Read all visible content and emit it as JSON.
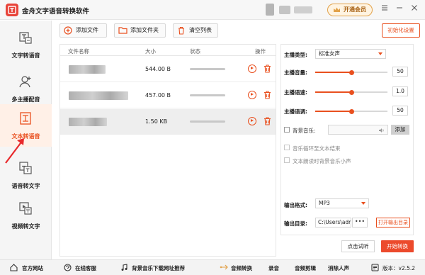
{
  "app": {
    "title": "金舟文字语音转换软件",
    "vip_label": "开通会员",
    "window_controls": [
      "menu-icon",
      "minimize-icon",
      "close-icon"
    ]
  },
  "sidebar": {
    "items": [
      {
        "label": "文字转语音",
        "icon": "text-to-speech-icon",
        "active": false
      },
      {
        "label": "多主播配音",
        "icon": "multi-anchor-icon",
        "active": false
      },
      {
        "label": "文本转语音",
        "icon": "document-to-speech-icon",
        "active": true
      },
      {
        "label": "语音转文字",
        "icon": "speech-to-text-icon",
        "active": false
      },
      {
        "label": "视频转文字",
        "icon": "video-to-text-icon",
        "active": false
      }
    ]
  },
  "toolbar": {
    "add_file": "添加文件",
    "add_folder": "添加文件夹",
    "clear_list": "清空列表",
    "init_settings": "初始化设置"
  },
  "file_table": {
    "columns": [
      "文件名称",
      "大小",
      "状态",
      "操作"
    ],
    "rows": [
      {
        "name_redacted": true,
        "size": "544.00 B",
        "selected": false
      },
      {
        "name_redacted": true,
        "size": "457.00 B",
        "selected": false
      },
      {
        "name_redacted": true,
        "size": "1.50 KB",
        "selected": true
      }
    ]
  },
  "settings": {
    "anchor_type_label": "主播类型:",
    "anchor_type_value": "标准女声",
    "volume_label": "主播音量:",
    "volume_value": "50",
    "volume_fraction": 0.5,
    "speed_label": "主播语速:",
    "speed_value": "1.0",
    "speed_fraction": 0.5,
    "pitch_label": "主播语调:",
    "pitch_value": "50",
    "pitch_fraction": 0.5,
    "bg_music_label": "背景音乐:",
    "add_label": "添加",
    "loop_label": "音乐循环至文本结束",
    "duck_label": "文本朗读时背景音乐小声",
    "output_format_label": "输出格式:",
    "output_format_value": "MP3",
    "output_dir_label": "输出目录:",
    "output_dir_value": "C:\\Users\\admir",
    "browse_label": "•••",
    "open_output_label": "打开输出目录"
  },
  "actions": {
    "trial_label": "点击试听",
    "start_label": "开始转换"
  },
  "footer": {
    "official_site": "官方网站",
    "online_support": "在线客服",
    "bg_music_download": "背景音乐下载网址推荐",
    "audio_convert": "音频转换",
    "record": "录音",
    "audio_edit": "音频剪辑",
    "vocal_remove": "消除人声",
    "version": "版本：v2.5.2"
  },
  "colors": {
    "accent": "#e9501f",
    "start_button": "#ec4a2c",
    "vip_border": "#e2a24a",
    "annotation_arrow": "#e8282b"
  }
}
